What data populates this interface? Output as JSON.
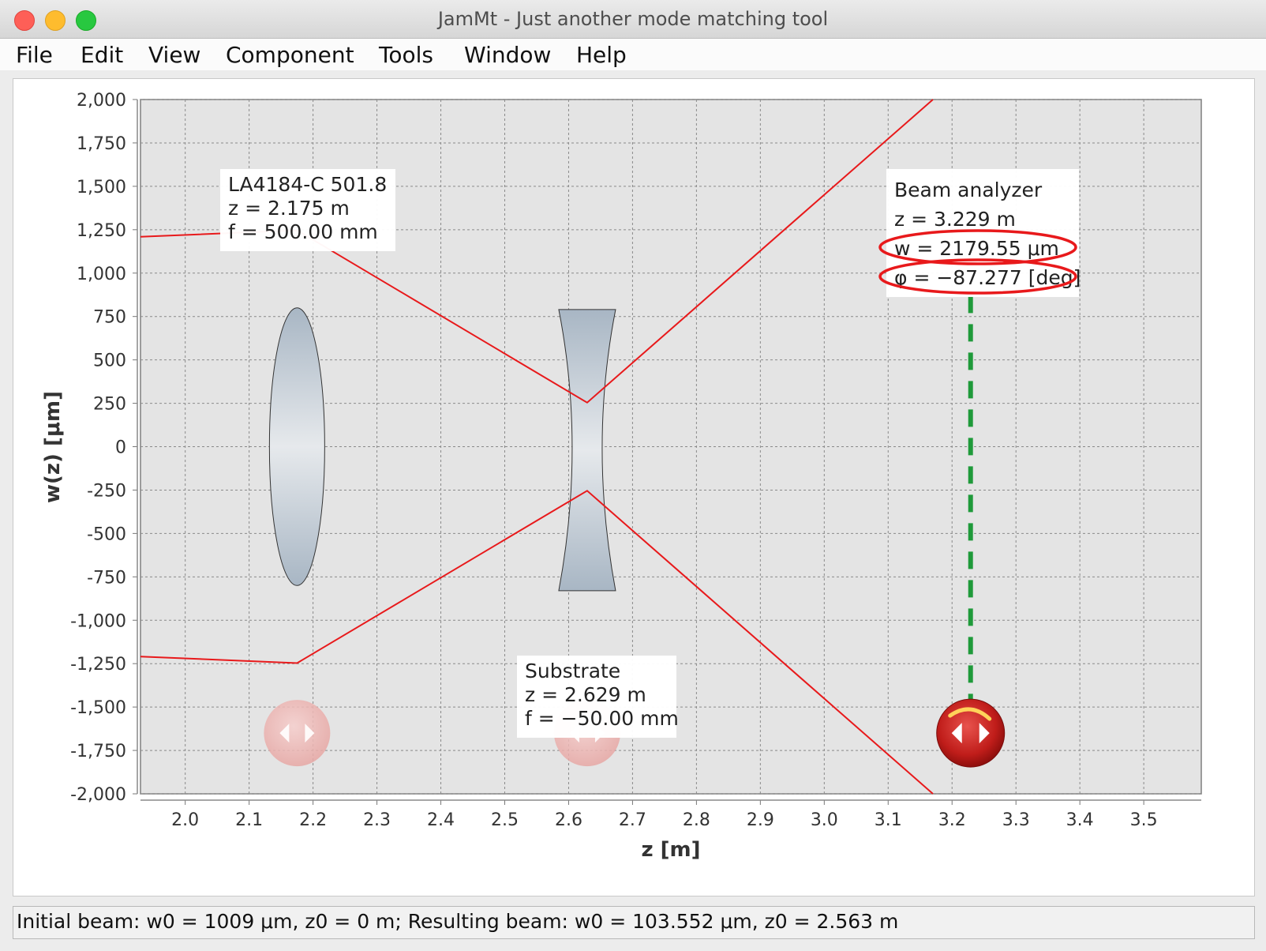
{
  "window": {
    "title": "JamMt - Just another mode matching tool"
  },
  "menu": {
    "items": [
      "File",
      "Edit",
      "View",
      "Component",
      "Tools",
      "Window",
      "Help"
    ]
  },
  "chart_data": {
    "type": "line",
    "xlabel": "z [m]",
    "ylabel": "w(z) [μm]",
    "xlim": [
      1.93,
      3.59
    ],
    "ylim": [
      -2000,
      2000
    ],
    "x_ticks": [
      "2.0",
      "2.1",
      "2.2",
      "2.3",
      "2.4",
      "2.5",
      "2.6",
      "2.7",
      "2.8",
      "2.9",
      "3.0",
      "3.1",
      "3.2",
      "3.3",
      "3.4",
      "3.5"
    ],
    "y_ticks": [
      "2,000",
      "1,750",
      "1,500",
      "1,250",
      "1,000",
      "750",
      "500",
      "250",
      "0",
      "-250",
      "-500",
      "-750",
      "-1,000",
      "-1,250",
      "-1,500",
      "-1,750",
      "-2,000"
    ],
    "grid": true,
    "series": [
      {
        "color": "#e8191b",
        "x": [
          1.93,
          2.175,
          2.629,
          3.17
        ],
        "y": [
          1209,
          1247,
          254,
          2000
        ]
      },
      {
        "color": "#e8191b",
        "x": [
          1.93,
          2.175,
          2.629,
          3.17
        ],
        "y": [
          -1209,
          -1247,
          -254,
          -2000
        ]
      }
    ],
    "components": [
      {
        "kind": "convex-lens",
        "z": 2.175,
        "label_lines": [
          "LA4184-C 501.8",
          "z = 2.175 m",
          "f = 500.00 mm"
        ]
      },
      {
        "kind": "concave-lens",
        "z": 2.629,
        "label_lines": [
          "Substrate",
          "z = 2.629 m",
          "f = −50.00 mm"
        ]
      },
      {
        "kind": "beam-analyzer",
        "z": 3.229,
        "label_lines": [
          "Beam analyzer",
          "z = 3.229 m",
          "w = 2179.55 μm",
          "φ = −87.277 [deg]"
        ]
      }
    ]
  },
  "status": {
    "text": "Initial beam: w0 = 1009 μm, z0 = 0 m; Resulting beam: w0 = 103.552 μm, z0 = 2.563 m"
  },
  "colors": {
    "plot_background": "#e4e4e4",
    "beam": "#e8191b",
    "analyzer_marker": "#1f9a3a",
    "highlight_ring": "#e8191b"
  }
}
